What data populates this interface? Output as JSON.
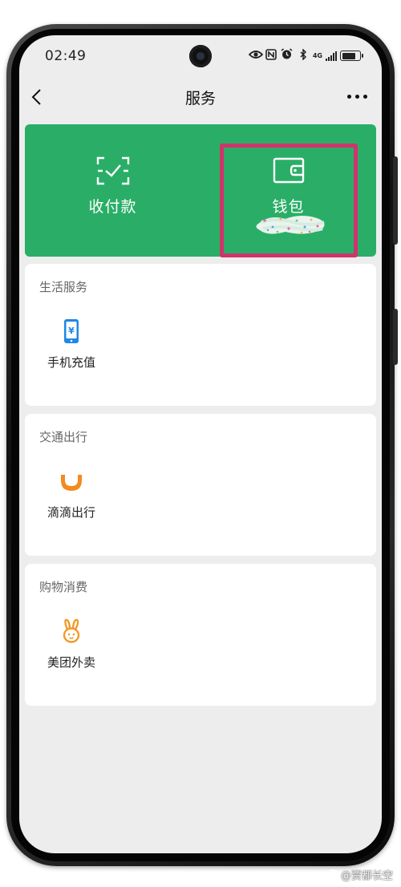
{
  "status_bar": {
    "time": "02:49",
    "network": "4G"
  },
  "nav": {
    "title": "服务"
  },
  "pay_card": {
    "collect_label": "收付款",
    "wallet_label": "钱包",
    "background_color": "#2aae67",
    "highlight_color": "#d1336c"
  },
  "sections": [
    {
      "title": "生活服务",
      "item": {
        "label": "手机充值",
        "icon": "phone-recharge-icon",
        "color": "#1e88e5"
      }
    },
    {
      "title": "交通出行",
      "item": {
        "label": "滴滴出行",
        "icon": "didi-icon",
        "color": "#f28b1f"
      }
    },
    {
      "title": "购物消费",
      "item": {
        "label": "美团外卖",
        "icon": "meituan-rabbit-icon",
        "color": "#f29a28"
      }
    }
  ],
  "watermark": {
    "text": "@贾都长空"
  }
}
